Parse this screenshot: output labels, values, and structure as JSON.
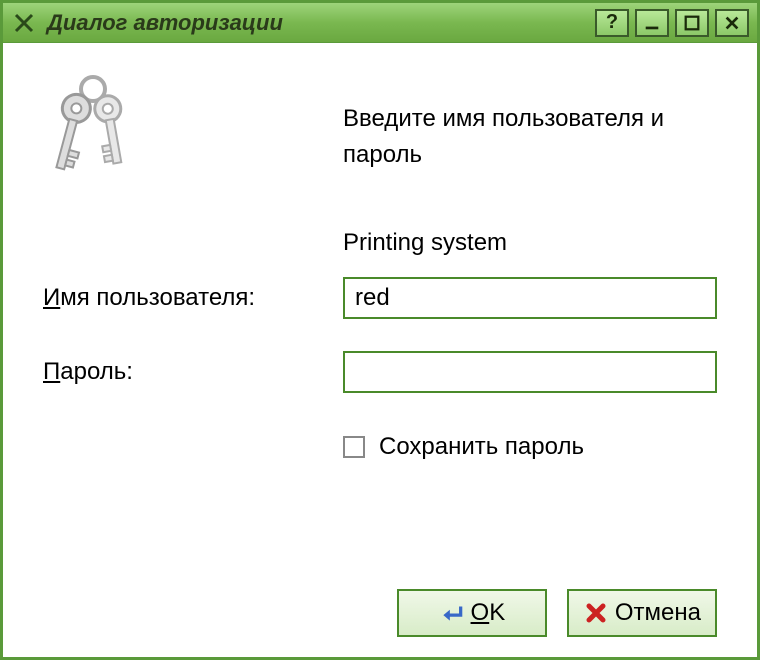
{
  "window": {
    "title": "Диалог авторизации"
  },
  "intro": {
    "prompt": "Введите имя пользователя и пароль",
    "subsystem": "Printing system"
  },
  "form": {
    "username_label_prefix": "И",
    "username_label_rest": "мя пользователя:",
    "username_value": "red",
    "password_label_prefix": "П",
    "password_label_rest": "ароль:",
    "password_value": "",
    "save_password_label": "Сохранить пароль"
  },
  "buttons": {
    "ok_prefix": "O",
    "ok_rest": "K",
    "cancel_label": "Отмена"
  }
}
